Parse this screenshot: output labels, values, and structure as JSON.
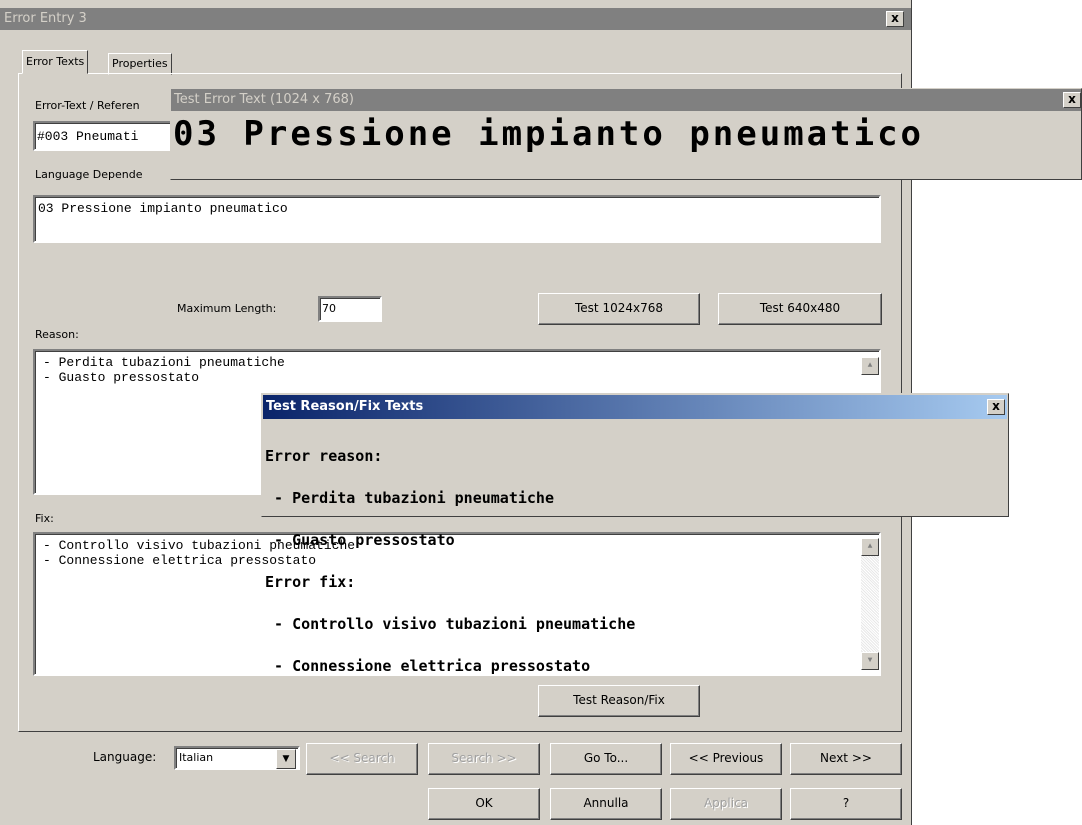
{
  "main_window": {
    "title": "Error Entry 3",
    "close_glyph": "x",
    "tabs": [
      {
        "label": "Error Texts"
      },
      {
        "label": "Properties"
      }
    ],
    "reference_label": "Error-Text / Referen",
    "reference_value": "#003 Pneumati",
    "language_dependent_label": "Language Depende",
    "language_text": "03 Pressione impianto pneumatico",
    "max_length_label": "Maximum Length:",
    "max_length_value": "70",
    "test_1024_button": "Test 1024x768",
    "test_640_button": "Test 640x480",
    "reason_label": "Reason:",
    "reason_lines": [
      "- Perdita tubazioni pneumatiche",
      "- Guasto pressostato"
    ],
    "fix_label": "Fix:",
    "fix_lines": [
      "- Controllo visivo tubazioni pneumatiche",
      "- Connessione elettrica pressostato"
    ],
    "test_reason_fix_button": "Test Reason/Fix",
    "language_label": "Language:",
    "language_value": "Italian",
    "search_prev_button": "<< Search",
    "search_next_button": "Search >>",
    "goto_button": "Go To...",
    "previous_button": "<< Previous",
    "next_button": "Next >>",
    "ok_button": "OK",
    "cancel_button": "Annulla",
    "apply_button": "Applica",
    "help_button": "?"
  },
  "test_error_window": {
    "title": "Test Error Text (1024 x 768)",
    "close_glyph": "x",
    "text": "03 Pressione impianto pneumatico"
  },
  "test_reason_window": {
    "title": "Test Reason/Fix Texts",
    "close_glyph": "x",
    "lines": [
      "Error reason:",
      " - Perdita tubazioni pneumatiche",
      " - Guasto pressostato",
      "Error fix:",
      " - Controllo visivo tubazioni pneumatiche",
      " - Connessione elettrica pressostato"
    ]
  },
  "colors": {
    "dialog_bg": "#d4d0c8",
    "inactive_title": "#808080",
    "active_title_start": "#0a246a",
    "active_title_end": "#a6caf0"
  }
}
